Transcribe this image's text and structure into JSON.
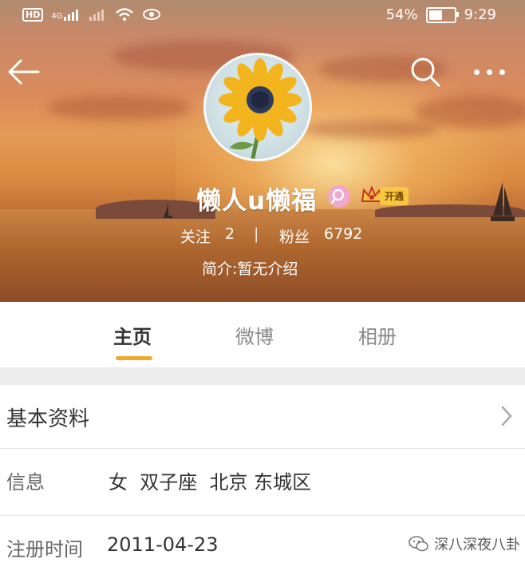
{
  "status_bar": {
    "hd": "HD",
    "network": "4G",
    "battery": "54%",
    "battery_level": 0.54,
    "time": "9:29"
  },
  "profile": {
    "username": "懒人u懒福",
    "vip_label": "开通",
    "following_label": "关注",
    "following_count": "2",
    "separator": "|",
    "followers_label": "粉丝",
    "followers_count": "6792",
    "bio": "简介:暂无介绍"
  },
  "tabs": [
    {
      "label": "主页",
      "active": true
    },
    {
      "label": "微博",
      "active": false
    },
    {
      "label": "相册",
      "active": false
    }
  ],
  "info": {
    "basic_title": "基本资料",
    "info_label": "信息",
    "info_value": "女  双子座  北京 东城区",
    "reg_label": "注册时间",
    "reg_value": "2011-04-23"
  },
  "watermark": {
    "text": "深八深夜八卦"
  },
  "colors": {
    "accent": "#f0a92f",
    "vip_gold": "#f7c744",
    "badge_pink": "#f0a6cf"
  },
  "icons": [
    "back-arrow-icon",
    "search-icon",
    "more-icon",
    "chevron-right-icon",
    "crown-icon",
    "wifi-icon",
    "eye-icon"
  ]
}
